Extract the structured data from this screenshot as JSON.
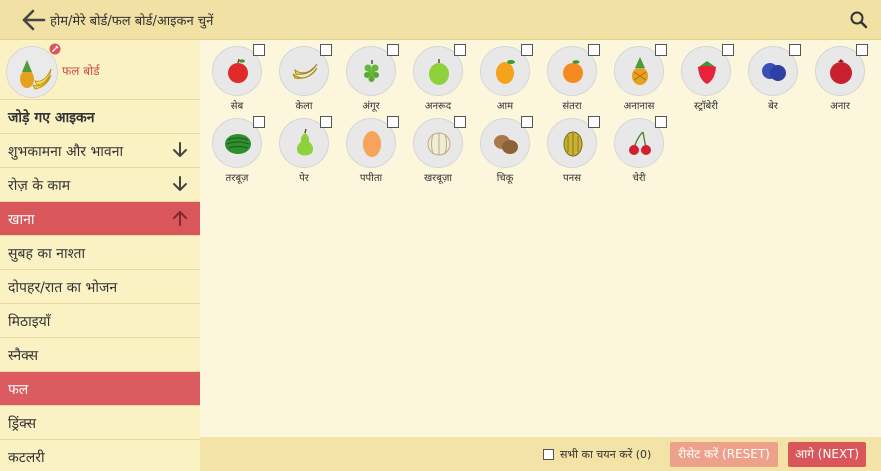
{
  "header": {
    "breadcrumb": "होम/मेरे बोर्ड/फल बोर्ड/आइकन चुनें",
    "back_icon": "arrow-left-icon",
    "search_icon": "search-icon"
  },
  "board": {
    "label": "फल बोर्ड"
  },
  "sidebar": {
    "items": [
      {
        "label": "जोड़े गए आइकन"
      },
      {
        "label": "शुभकामना और भावना"
      },
      {
        "label": "रोज़ के काम"
      },
      {
        "label": "खाना"
      },
      {
        "label": "सुबह का नाश्ता"
      },
      {
        "label": "दोपहर/रात का भोजन"
      },
      {
        "label": "मिठाइयाँ"
      },
      {
        "label": "स्नैक्स"
      },
      {
        "label": "फल"
      },
      {
        "label": "ड्रिंक्स"
      },
      {
        "label": "कटलरी"
      }
    ]
  },
  "icons": [
    {
      "name": "सेब",
      "fruit": "apple-icon"
    },
    {
      "name": "केला",
      "fruit": "banana-icon"
    },
    {
      "name": "अंगूर",
      "fruit": "grapes-icon"
    },
    {
      "name": "अनरूद",
      "fruit": "guava-icon"
    },
    {
      "name": "आम",
      "fruit": "mango-icon"
    },
    {
      "name": "संतरा",
      "fruit": "orange-icon"
    },
    {
      "name": "अनानास",
      "fruit": "pineapple-icon"
    },
    {
      "name": "स्ट्रॉबेरी",
      "fruit": "strawberry-icon"
    },
    {
      "name": "बेर",
      "fruit": "plum-icon"
    },
    {
      "name": "अनार",
      "fruit": "pomegranate-icon"
    },
    {
      "name": "तरबूज़",
      "fruit": "watermelon-icon"
    },
    {
      "name": "पेर",
      "fruit": "pear-icon"
    },
    {
      "name": "पपीता",
      "fruit": "papaya-icon"
    },
    {
      "name": "खरबूज़ा",
      "fruit": "muskmelon-icon"
    },
    {
      "name": "चिकू",
      "fruit": "chikoo-icon"
    },
    {
      "name": "पनस",
      "fruit": "jackfruit-icon"
    },
    {
      "name": "चेरी",
      "fruit": "cherry-icon"
    }
  ],
  "footer": {
    "select_all": "सभी का चयन करें (0)",
    "reset": "रीसेट करें (RESET)",
    "next": "आगे (NEXT)"
  },
  "colors": {
    "accent": "#d9565a",
    "topbar": "#f1e1a4",
    "sidebar": "#fbf2c4",
    "content": "#fbf6dc",
    "reset": "#eda18a"
  }
}
